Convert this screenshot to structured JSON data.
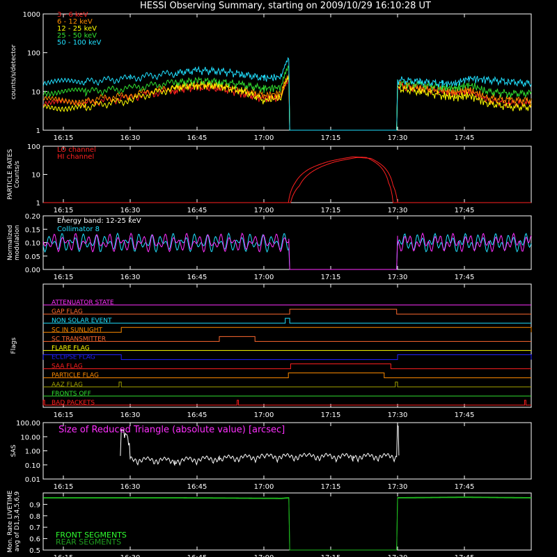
{
  "title": "HESSI Observing Summary, starting on 2009/10/29 16:10:28 UT",
  "time_axis": {
    "ticks": [
      "16:15",
      "16:30",
      "16:45",
      "17:00",
      "17:15",
      "17:30",
      "17:45"
    ],
    "tick_minutes": [
      975,
      990,
      1005,
      1020,
      1035,
      1050,
      1065
    ],
    "range_minutes": [
      970.47,
      1080
    ]
  },
  "colors": {
    "red": "#ff2020",
    "orange": "#ff8c00",
    "yellow": "#ffff00",
    "green": "#30e030",
    "cyan": "#20e0ff",
    "magenta": "#ff30ff",
    "blue": "#2020ff",
    "olive": "#a0a000",
    "darkorange": "#ff6a30",
    "livetime": "#20c020",
    "grey": "#808080"
  },
  "chart_data": [
    {
      "type": "line",
      "id": "count_rates",
      "ylabel": "counts/s/detector",
      "yscale": "log",
      "ylim": [
        1,
        1000
      ],
      "yticks": [
        "1",
        "10",
        "100",
        "1000"
      ],
      "yticks_values": [
        1,
        10,
        100,
        1000
      ],
      "legend_placement": "top-left",
      "series": [
        {
          "name": "3 - 6 keV",
          "color": "red",
          "x": [
            970.5,
            980,
            990,
            1000,
            1005,
            1010,
            1015,
            1020,
            1024,
            1025.6,
            1025.8,
            1049.8,
            1050,
            1055,
            1060,
            1063,
            1066,
            1070,
            1075,
            1080
          ],
          "y": [
            5,
            5,
            7,
            11,
            13,
            12,
            9,
            6.5,
            7,
            20,
            1,
            1,
            14,
            12,
            10,
            9,
            10,
            6,
            5,
            5
          ]
        },
        {
          "name": "6 - 12 keV",
          "color": "orange",
          "x": [
            970.5,
            980,
            990,
            1000,
            1005,
            1010,
            1015,
            1020,
            1024,
            1025.6,
            1025.8,
            1049.8,
            1050,
            1055,
            1060,
            1063,
            1066,
            1070,
            1075,
            1080
          ],
          "y": [
            6,
            6,
            8,
            13,
            15,
            14,
            11,
            8,
            9,
            25,
            1,
            1,
            15,
            13,
            11,
            10,
            11,
            7,
            6,
            6
          ]
        },
        {
          "name": "12 - 25 keV",
          "color": "yellow",
          "x": [
            970.5,
            980,
            990,
            1000,
            1005,
            1010,
            1015,
            1020,
            1024,
            1025.6,
            1025.8,
            1049.8,
            1050,
            1055,
            1060,
            1063,
            1066,
            1070,
            1075,
            1080
          ],
          "y": [
            4,
            4,
            6,
            12,
            15,
            14,
            10,
            6,
            7,
            22,
            1,
            1,
            12,
            10,
            8,
            7,
            8,
            5,
            4,
            4
          ]
        },
        {
          "name": "25 - 50 keV",
          "color": "green",
          "x": [
            970.5,
            980,
            990,
            1000,
            1005,
            1010,
            1015,
            1020,
            1024,
            1025.6,
            1025.8,
            1049.8,
            1050,
            1055,
            1060,
            1063,
            1066,
            1070,
            1075,
            1080
          ],
          "y": [
            10,
            10,
            12,
            17,
            19,
            18,
            15,
            12,
            13,
            40,
            1,
            1,
            17,
            15,
            13,
            12,
            15,
            10,
            9,
            9
          ]
        },
        {
          "name": "50 - 100 keV",
          "color": "cyan",
          "x": [
            970.5,
            980,
            990,
            1000,
            1005,
            1010,
            1015,
            1020,
            1024,
            1025.6,
            1025.8,
            1049.8,
            1050,
            1055,
            1060,
            1063,
            1066,
            1070,
            1075,
            1080
          ],
          "y": [
            17,
            18,
            22,
            30,
            35,
            34,
            28,
            22,
            24,
            65,
            1,
            1,
            20,
            18,
            16,
            16,
            22,
            20,
            18,
            16
          ]
        }
      ]
    },
    {
      "type": "line",
      "id": "particle_rates",
      "ylabel": "PARTICLE RATES Counts/s",
      "yscale": "log",
      "ylim": [
        1,
        100
      ],
      "yticks": [
        "1",
        "10",
        "100"
      ],
      "yticks_values": [
        1,
        10,
        100
      ],
      "legend_placement": "top-left",
      "series": [
        {
          "name": "LO channel",
          "color": "red",
          "x": [
            970.5,
            1025.5,
            1027,
            1030,
            1035,
            1040,
            1043,
            1046,
            1048,
            1049,
            1080
          ],
          "y": [
            1,
            1,
            5,
            15,
            30,
            42,
            40,
            20,
            5,
            1,
            1
          ]
        },
        {
          "name": "HI channel",
          "color": "red",
          "x": [
            970.5,
            1026,
            1028,
            1031,
            1036,
            1041,
            1044,
            1047,
            1049,
            1050,
            1080
          ],
          "y": [
            1,
            1,
            4,
            13,
            28,
            40,
            37,
            18,
            4,
            1,
            1
          ]
        }
      ]
    },
    {
      "type": "line",
      "id": "modulation",
      "ylabel": "Normalized modulation",
      "ylim": [
        0,
        0.2
      ],
      "yticks": [
        "0.00",
        "0.05",
        "0.10",
        "0.15",
        "0.20"
      ],
      "yticks_values": [
        0,
        0.05,
        0.1,
        0.15,
        0.2
      ],
      "annotations": [
        "Energy band: 12-25 keV"
      ],
      "legend_placement": "top-left",
      "series": [
        {
          "name": "Collimator 8",
          "color": "cyan",
          "x": [
            970.5,
            1025.6,
            1025.8,
            1049.8,
            1050,
            1080
          ],
          "y": [
            0.1,
            0.1,
            0,
            0,
            0.1,
            0.1
          ]
        },
        {
          "name": "",
          "color": "magenta",
          "x": [
            970.5,
            1025.6,
            1025.8,
            1049.8,
            1050,
            1080
          ],
          "y": [
            0.1,
            0.1,
            0,
            0,
            0.1,
            0.1
          ]
        }
      ]
    },
    {
      "type": "line",
      "id": "sas",
      "ylabel": "SAS",
      "yscale": "log",
      "ylim": [
        0.01,
        100
      ],
      "yticks": [
        "0.01",
        "0.10",
        "1.00",
        "10.00",
        "100.00"
      ],
      "yticks_values": [
        0.01,
        0.1,
        1,
        10,
        100
      ],
      "annotations": [
        "Size of Reduced Triangle (absolute value) [arcsec]"
      ],
      "series": [
        {
          "name": "",
          "color": "white",
          "x": [
            987.8,
            988,
            990,
            1000,
            1010,
            1020,
            1030,
            1040,
            1049.8,
            1050,
            1050.3
          ],
          "y": [
            0.5,
            30,
            0.25,
            0.22,
            0.3,
            0.4,
            0.42,
            0.42,
            0.42,
            80,
            0.5
          ]
        }
      ]
    },
    {
      "type": "line",
      "id": "livetime",
      "ylabel": "Mon. Rate LIVETIME avg of D1,3,4,5,6,9",
      "ylim": [
        0.5,
        1.0
      ],
      "yticks": [
        "0.5",
        "0.6",
        "0.7",
        "0.8",
        "0.9"
      ],
      "yticks_values": [
        0.5,
        0.6,
        0.7,
        0.8,
        0.9
      ],
      "legend_placement": "bottom-left",
      "series": [
        {
          "name": "FRONT SEGMENTS",
          "color": "livetime",
          "x": [
            970.5,
            1000,
            1024,
            1025.6,
            1025.8,
            1049.8,
            1050,
            1065,
            1080
          ],
          "y": [
            0.96,
            0.96,
            0.955,
            0.96,
            0.5,
            0.5,
            0.96,
            0.965,
            0.96
          ]
        },
        {
          "name": "REAR SEGMENTS",
          "color": "livetime",
          "x": [
            970.5,
            1000,
            1024,
            1025.6,
            1025.8,
            1049.8,
            1050,
            1065,
            1080
          ],
          "y": [
            0.955,
            0.955,
            0.95,
            0.955,
            0.5,
            0.5,
            0.955,
            0.96,
            0.955
          ]
        }
      ]
    }
  ],
  "flags_panel": {
    "ylabel": "Flags",
    "flags": [
      {
        "name": "ATTENUATOR STATE",
        "color": "magenta",
        "segments": []
      },
      {
        "name": "GAP FLAG",
        "color": "darkorange",
        "segments": [
          [
            1025.8,
            1049.8
          ]
        ]
      },
      {
        "name": "NON SOLAR EVENT",
        "color": "cyan",
        "segments": [
          [
            1024.8,
            1025.8
          ]
        ]
      },
      {
        "name": "SC IN SUNLIGHT",
        "color": "orange",
        "segments": [
          [
            988,
            1080
          ]
        ]
      },
      {
        "name": "SC TRANSMITTER",
        "color": "darkorange",
        "segments": [
          [
            1010,
            1018
          ]
        ]
      },
      {
        "name": "FLARE FLAG",
        "color": "yellow",
        "segments": []
      },
      {
        "name": "ECLIPSE FLAG",
        "color": "blue",
        "segments": [
          [
            970.5,
            988
          ],
          [
            1050,
            1080
          ]
        ]
      },
      {
        "name": "SAA FLAG",
        "color": "red",
        "segments": [
          [
            1026,
            1048.5
          ]
        ]
      },
      {
        "name": "PARTICLE FLAG",
        "color": "orange",
        "segments": [
          [
            1025.5,
            1047
          ]
        ]
      },
      {
        "name": "AAZ FLAG",
        "color": "olive",
        "segments": [
          [
            987.5,
            988
          ],
          [
            1049.5,
            1050
          ]
        ]
      },
      {
        "name": "FRONTS OFF",
        "color": "green",
        "segments": []
      },
      {
        "name": "BAD PACKETS",
        "color": "red",
        "segments": [
          [
            970.5,
            970.8
          ],
          [
            1014,
            1014.3
          ],
          [
            1078.5,
            1078.8
          ]
        ]
      }
    ]
  }
}
